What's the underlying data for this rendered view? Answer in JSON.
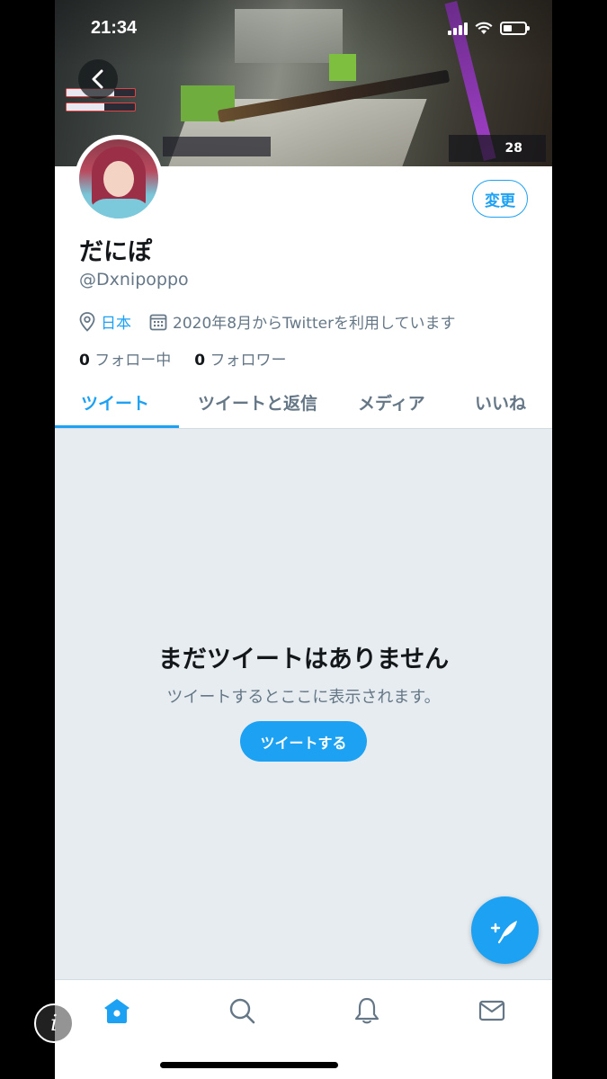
{
  "status_bar": {
    "time": "21:34"
  },
  "profile": {
    "display_name": "だにぽ",
    "handle": "@Dxnipoppo",
    "location": "日本",
    "joined": "2020年8月からTwitterを利用しています",
    "following_count": "0",
    "following_label": "フォロー中",
    "followers_count": "0",
    "followers_label": "フォロワー",
    "edit_label": "変更"
  },
  "banner": {
    "hud_ammo": "28"
  },
  "tabs": [
    {
      "label": "ツイート",
      "active": true
    },
    {
      "label": "ツイートと返信",
      "active": false
    },
    {
      "label": "メディア",
      "active": false
    },
    {
      "label": "いいね",
      "active": false
    }
  ],
  "empty_state": {
    "title": "まだツイートはありません",
    "subtitle": "ツイートするとここに表示されます。",
    "button": "ツイートする"
  },
  "bottom_nav": [
    "home-icon",
    "search-icon",
    "bell-icon",
    "mail-icon"
  ],
  "colors": {
    "accent": "#1da1f2",
    "text": "#14171a",
    "muted": "#657786",
    "empty_bg": "#e6ecf0"
  }
}
